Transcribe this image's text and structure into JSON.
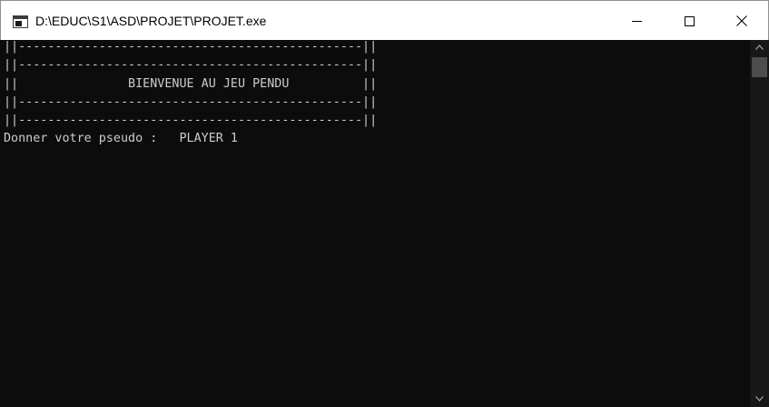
{
  "window": {
    "title": "D:\\EDUC\\S1\\ASD\\PROJET\\PROJET.exe",
    "app_icon": "console-window-icon",
    "controls": {
      "minimize_icon": "minimize-icon",
      "maximize_icon": "maximize-icon",
      "close_icon": "close-icon"
    }
  },
  "console": {
    "lines": [
      "||-----------------------------------------------||",
      "||-----------------------------------------------||",
      "||               BIENVENUE AU JEU PENDU          ||",
      "||-----------------------------------------------||",
      "||-----------------------------------------------||",
      "Donner votre pseudo :   PLAYER 1"
    ],
    "text_color": "#cccccc",
    "background_color": "#0c0c0c"
  },
  "scrollbar": {
    "up_icon": "scroll-up-arrow-icon",
    "down_icon": "scroll-down-arrow-icon"
  }
}
